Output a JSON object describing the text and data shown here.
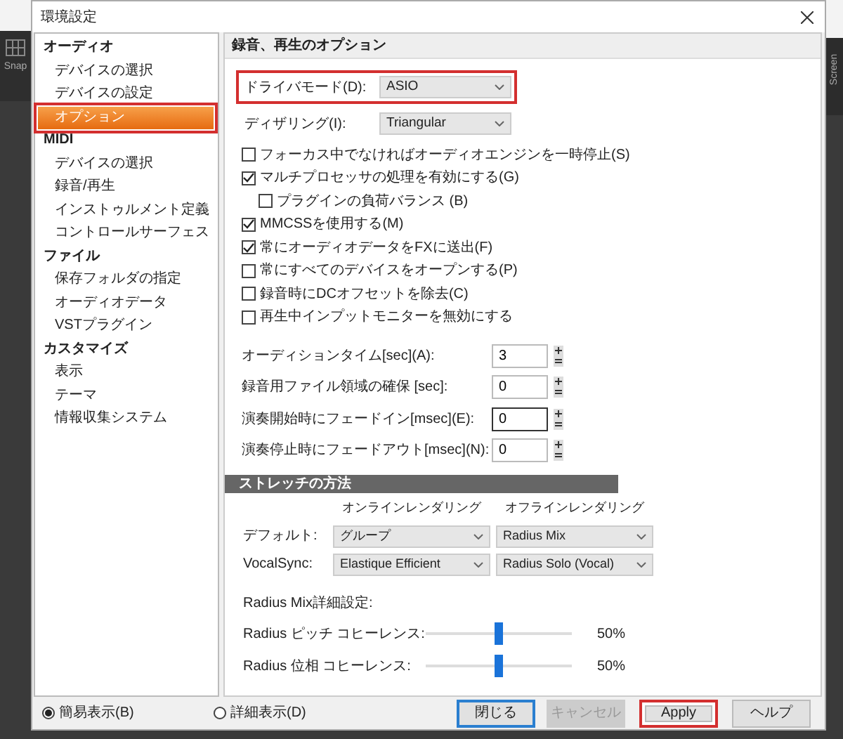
{
  "background": {
    "toolbar_label": "Snap",
    "side_label": "Screen"
  },
  "window": {
    "title": "環境設定"
  },
  "sidebar": {
    "groups": [
      {
        "label": "オーディオ",
        "items": [
          {
            "label": "デバイスの選択",
            "selected": false,
            "highlighted": false
          },
          {
            "label": "デバイスの設定",
            "selected": false,
            "highlighted": false
          },
          {
            "label": "オプション",
            "selected": true,
            "highlighted": true
          }
        ]
      },
      {
        "label": "MIDI",
        "items": [
          {
            "label": "デバイスの選択",
            "selected": false,
            "highlighted": false
          },
          {
            "label": "録音/再生",
            "selected": false,
            "highlighted": false
          },
          {
            "label": "インストゥルメント定義",
            "selected": false,
            "highlighted": false
          },
          {
            "label": "コントロールサーフェス",
            "selected": false,
            "highlighted": false
          }
        ]
      },
      {
        "label": "ファイル",
        "items": [
          {
            "label": "保存フォルダの指定",
            "selected": false,
            "highlighted": false
          },
          {
            "label": "オーディオデータ",
            "selected": false,
            "highlighted": false
          },
          {
            "label": "VSTプラグイン",
            "selected": false,
            "highlighted": false
          }
        ]
      },
      {
        "label": "カスタマイズ",
        "items": [
          {
            "label": "表示",
            "selected": false,
            "highlighted": false
          },
          {
            "label": "テーマ",
            "selected": false,
            "highlighted": false
          },
          {
            "label": "情報収集システム",
            "selected": false,
            "highlighted": false
          }
        ]
      }
    ]
  },
  "panel": {
    "title": "録音、再生のオプション",
    "selects": [
      {
        "label": "ドライバモード(D):",
        "value": "ASIO",
        "highlighted": true
      },
      {
        "label": "ディザリング(I):",
        "value": "Triangular",
        "highlighted": false
      }
    ],
    "checkboxes": [
      {
        "label": "フォーカス中でなければオーディオエンジンを一時停止(S)",
        "checked": false
      },
      {
        "label": "マルチプロセッサの処理を有効にする(G)",
        "checked": true,
        "children": [
          {
            "label": "プラグインの負荷バランス (B)",
            "checked": false
          }
        ]
      },
      {
        "label": "MMCSSを使用する(M)",
        "checked": true
      },
      {
        "label": "常にオーディオデータをFXに送出(F)",
        "checked": true
      },
      {
        "label": "常にすべてのデバイスをオープンする(P)",
        "checked": false
      },
      {
        "label": "録音時にDCオフセットを除去(C)",
        "checked": false
      },
      {
        "label": "再生中インプットモニターを無効にする",
        "checked": false
      }
    ],
    "number_fields": [
      {
        "label": "オーディションタイム[sec](A):",
        "value": "3",
        "focused": false
      },
      {
        "label": "録音用ファイル領域の確保 [sec]:",
        "value": "0",
        "focused": false
      },
      {
        "label": "演奏開始時にフェードイン[msec](E):",
        "value": "0",
        "focused": true
      },
      {
        "label": "演奏停止時にフェードアウト[msec](N):",
        "value": "0",
        "focused": false
      }
    ],
    "stretch": {
      "title": "ストレッチの方法",
      "columns": [
        "オンラインレンダリング",
        "オフラインレンダリング"
      ],
      "rows": [
        {
          "label": "デフォルト:",
          "online": "グループ",
          "offline": "Radius Mix"
        },
        {
          "label": "VocalSync:",
          "online": "Elastique Efficient",
          "offline": "Radius Solo (Vocal)"
        }
      ]
    },
    "radius": {
      "title": "Radius Mix詳細設定:",
      "sliders": [
        {
          "label": "Radius ピッチ コヒーレンス:",
          "level": 0.5,
          "reading": "50%"
        },
        {
          "label": "Radius 位相 コヒーレンス:",
          "level": 0.5,
          "reading": "50%"
        }
      ]
    }
  },
  "footer": {
    "view_modes": [
      {
        "label": "簡易表示(B)",
        "selected": true
      },
      {
        "label": "詳細表示(D)",
        "selected": false
      }
    ],
    "buttons": [
      {
        "label": "閉じる",
        "default": true,
        "disabled": false,
        "highlighted": false
      },
      {
        "label": "キャンセル",
        "default": false,
        "disabled": true,
        "highlighted": false
      },
      {
        "label": "Apply",
        "default": false,
        "disabled": false,
        "highlighted": true
      },
      {
        "label": "ヘルプ",
        "default": false,
        "disabled": false,
        "highlighted": false
      }
    ]
  }
}
